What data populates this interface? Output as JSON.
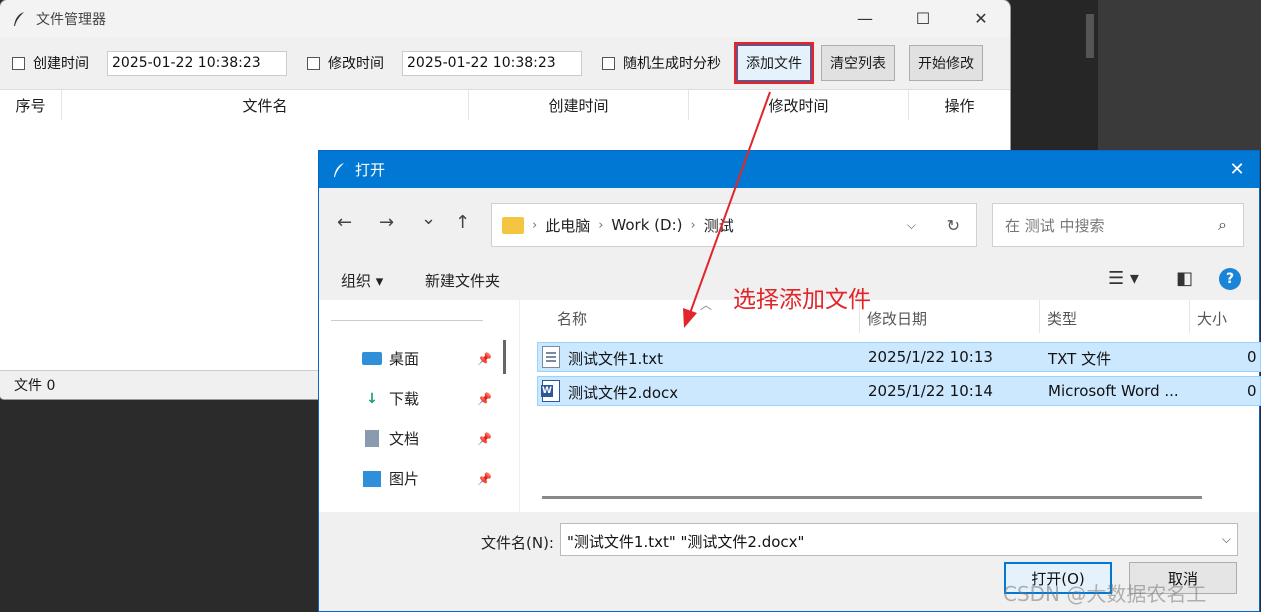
{
  "main_window": {
    "title": "文件管理器",
    "controls": {
      "minimize": "—",
      "maximize": "☐",
      "close": "✕"
    },
    "toolbar": {
      "create_time_label": "创建时间",
      "create_time_value": "2025-01-22 10:38:23",
      "modify_time_label": "修改时间",
      "modify_time_value": "2025-01-22 10:38:23",
      "random_label": "随机生成时分秒",
      "add_file": "添加文件",
      "clear_list": "清空列表",
      "start_modify": "开始修改"
    },
    "table_headers": [
      "序号",
      "文件名",
      "创建时间",
      "修改时间",
      "操作"
    ],
    "status": "文件 0"
  },
  "annotation": {
    "text": "选择添加文件",
    "color": "#e0262a"
  },
  "dialog": {
    "title": "打开",
    "close": "✕",
    "nav": {
      "back": "←",
      "forward": "→",
      "recent": "⌄",
      "up": "↑"
    },
    "breadcrumb": [
      "此电脑",
      "Work (D:)",
      "测试"
    ],
    "search_placeholder": "在 测试 中搜索",
    "commands": {
      "organize": "组织 ▾",
      "new_folder": "新建文件夹",
      "help": "?"
    },
    "nav_items": [
      {
        "label": "桌面",
        "icon": "desktop-icon"
      },
      {
        "label": "下载",
        "icon": "download-icon"
      },
      {
        "label": "文档",
        "icon": "document-icon"
      },
      {
        "label": "图片",
        "icon": "pictures-icon"
      }
    ],
    "columns": [
      "名称",
      "修改日期",
      "类型",
      "大小"
    ],
    "files": [
      {
        "name": "测试文件1.txt",
        "date": "2025/1/22 10:13",
        "type": "TXT 文件",
        "size": "0",
        "icon": "txt-file-icon"
      },
      {
        "name": "测试文件2.docx",
        "date": "2025/1/22 10:14",
        "type": "Microsoft Word ...",
        "size": "0",
        "icon": "word-file-icon"
      }
    ],
    "filename_label": "文件名(N):",
    "filename_value": "\"测试文件1.txt\" \"测试文件2.docx\"",
    "open_button": "打开(O)",
    "cancel_button": "取消"
  },
  "watermark": "CSDN @大数据农名工",
  "colors": {
    "accent": "#0078d4",
    "selection": "#cce8ff",
    "highlight": "#e0262a"
  }
}
